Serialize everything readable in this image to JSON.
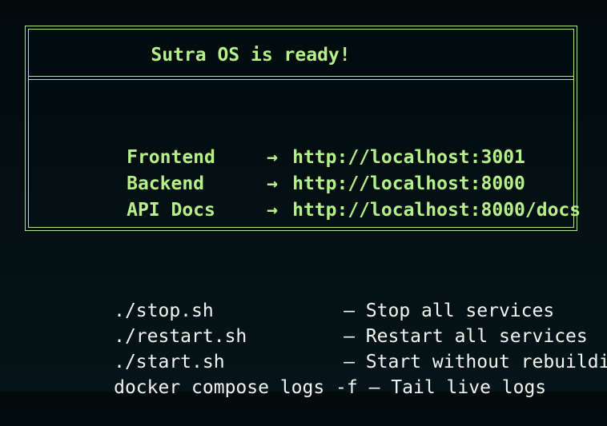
{
  "banner": {
    "title": "Sutra OS is ready!"
  },
  "services": [
    {
      "name": "Frontend",
      "arrow": "→",
      "url": "http://localhost:3001"
    },
    {
      "name": "Backend",
      "arrow": "→",
      "url": "http://localhost:8000"
    },
    {
      "name": "API Docs",
      "arrow": "→",
      "url": "http://localhost:8000/docs"
    }
  ],
  "commands": [
    {
      "cmd": "./stop.sh",
      "desc": "— Stop all services"
    },
    {
      "cmd": "./restart.sh",
      "desc": "— Restart all services"
    },
    {
      "cmd": "./start.sh",
      "desc": "— Start without rebuilding"
    },
    {
      "cmd": "docker compose logs -f",
      "desc": "— Tail live logs"
    }
  ],
  "colors": {
    "background": "#041013",
    "accent_green": "#b5f08a",
    "text_white": "#f2f4f2"
  }
}
